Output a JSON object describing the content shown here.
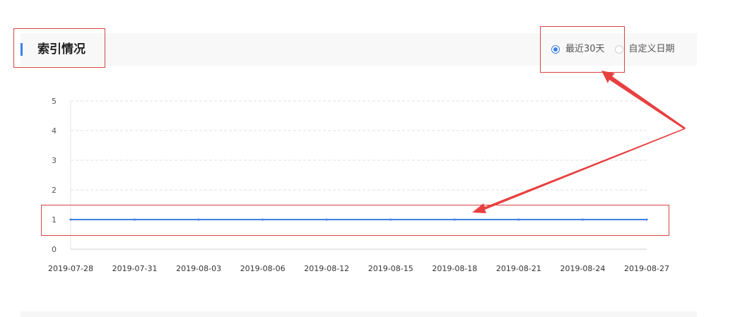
{
  "header": {
    "title": "索引情况"
  },
  "range_selector": {
    "options": [
      {
        "label": "最近30天",
        "selected": true
      },
      {
        "label": "自定义日期",
        "selected": false
      }
    ]
  },
  "colors": {
    "accent": "#3e7fe6",
    "series_line": "#3e7fe6",
    "annotation": "#e84040",
    "grid": "#e2e2e2"
  },
  "chart_data": {
    "type": "line",
    "x": [
      "2019-07-28",
      "2019-07-31",
      "2019-08-03",
      "2019-08-06",
      "2019-08-12",
      "2019-08-15",
      "2019-08-18",
      "2019-08-21",
      "2019-08-24",
      "2019-08-27"
    ],
    "series": [
      {
        "values": [
          1,
          1,
          1,
          1,
          1,
          1,
          1,
          1,
          1,
          1
        ]
      }
    ],
    "y_ticks": [
      0,
      1,
      2,
      3,
      4,
      5
    ],
    "ylim": [
      0,
      5
    ],
    "grid": true,
    "title": "",
    "xlabel": "",
    "ylabel": ""
  }
}
